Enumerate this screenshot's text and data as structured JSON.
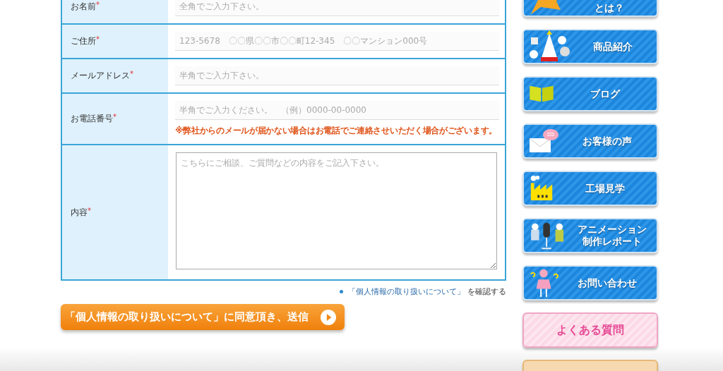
{
  "form": {
    "rows": [
      {
        "label": "お名前",
        "mark": "*",
        "kind": "input",
        "placeholder": "全角でご入力下さい。"
      },
      {
        "label": "ご住所",
        "mark": "*",
        "kind": "input",
        "placeholder": "123-5678　〇〇県〇〇市〇〇町12-345　〇〇マンション000号"
      },
      {
        "label": "メールアドレス",
        "mark": "*",
        "kind": "input",
        "placeholder": "半角でご入力下さい。"
      },
      {
        "label": "お電話番号",
        "mark": "*",
        "kind": "input",
        "placeholder": "半角でご入力ください。　（例）0000-00-0000",
        "note": "※弊社からのメールが届かない場合はお電話でご連絡させいただく場合がございます。"
      },
      {
        "label": "内容",
        "mark": "*",
        "kind": "textarea",
        "placeholder": "こちらにご相談、ご質問などの内容をご記入下さい。"
      }
    ]
  },
  "privacy": {
    "link": "「個人情報の取り扱いについて」",
    "text": "を確認する"
  },
  "submit": {
    "label": "「個人情報の取り扱いについて」に同意頂き、送信"
  },
  "nav": [
    {
      "kind": "primary",
      "lines": [
        "とは？"
      ]
    },
    {
      "kind": "primary",
      "lines": [
        "商品紹介"
      ]
    },
    {
      "kind": "primary",
      "lines": [
        "ブログ"
      ]
    },
    {
      "kind": "primary",
      "lines": [
        "お客様の声"
      ]
    },
    {
      "kind": "primary",
      "lines": [
        "工場見学"
      ]
    },
    {
      "kind": "primary",
      "lines": [
        "アニメーション",
        "制作レポート"
      ]
    },
    {
      "kind": "primary",
      "lines": [
        "お問い合わせ"
      ]
    },
    {
      "kind": "secondary",
      "lines": [
        "よくある質問"
      ]
    },
    {
      "kind": "tertiary"
    }
  ]
}
